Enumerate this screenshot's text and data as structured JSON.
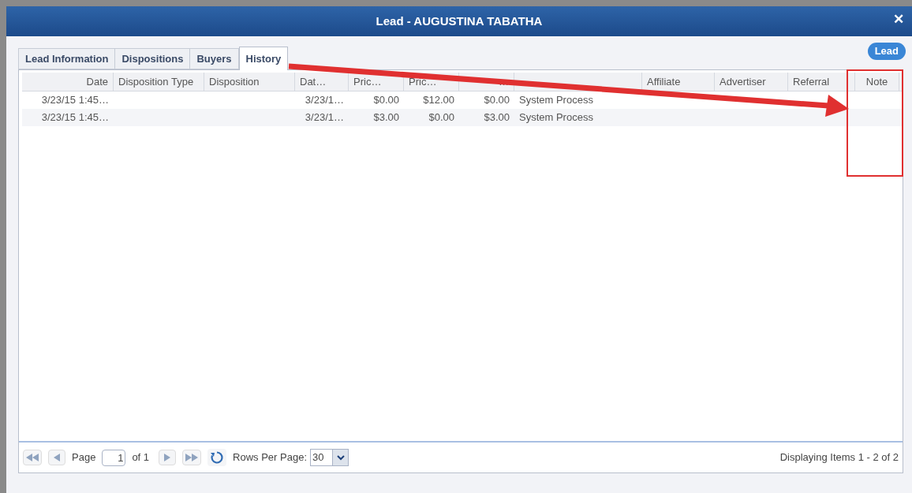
{
  "window": {
    "title": "Lead - AUGUSTINA TABATHA",
    "close": "✕"
  },
  "badge": "Lead",
  "tabs": [
    {
      "label": "Lead Information",
      "selected": false
    },
    {
      "label": "Dispositions",
      "selected": false
    },
    {
      "label": "Buyers",
      "selected": false
    },
    {
      "label": "History",
      "selected": true
    }
  ],
  "table": {
    "columns": [
      {
        "label": "Date"
      },
      {
        "label": "Disposition Type"
      },
      {
        "label": "Disposition"
      },
      {
        "label": "Dat…"
      },
      {
        "label": "Pric…"
      },
      {
        "label": "Pric…"
      },
      {
        "label": "…"
      },
      {},
      {
        "label": "Affiliate"
      },
      {
        "label": "Advertiser"
      },
      {
        "label": "Referral"
      },
      {
        "label": "Note"
      }
    ],
    "rows": [
      [
        "3/23/15 1:45…",
        "",
        "",
        "3/23/1…",
        "$0.00",
        "$12.00",
        "$0.00",
        "System Process",
        "",
        "",
        "",
        ""
      ],
      [
        "3/23/15 1:45…",
        "",
        "",
        "3/23/1…",
        "$3.00",
        "$0.00",
        "$3.00",
        "System Process",
        "",
        "",
        "",
        ""
      ]
    ]
  },
  "pager": {
    "page_label": "Page",
    "page": "1",
    "of": "of 1",
    "rows_label": "Rows Per Page:",
    "rows_per_page": "30",
    "summary": "Displaying Items 1 - 2 of 2"
  },
  "annotations": {
    "arrow": true,
    "highlight_box": true
  }
}
